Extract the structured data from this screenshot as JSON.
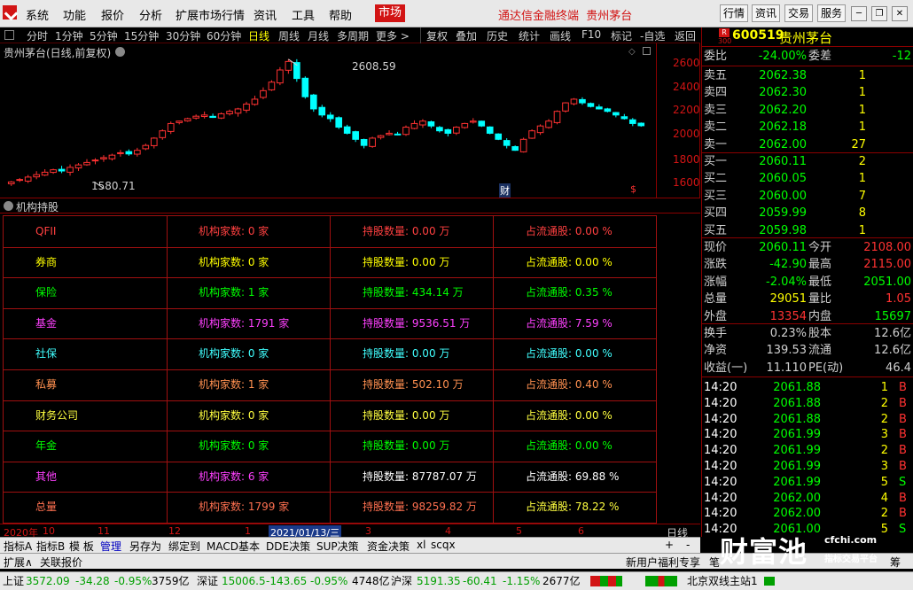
{
  "menubar": {
    "menus": [
      "系统",
      "功能",
      "报价",
      "分析",
      "扩展市场行情",
      "资讯",
      "工具",
      "帮助"
    ],
    "active_menu": "市场",
    "brand_text": "通达信金融终端",
    "brand_stock": "贵州茅台",
    "right_buttons": [
      "行情",
      "资讯",
      "交易",
      "服务"
    ]
  },
  "periodbar": {
    "items": [
      "分时",
      "1分钟",
      "5分钟",
      "15分钟",
      "30分钟",
      "60分钟",
      "日线",
      "周线",
      "月线",
      "多周期",
      "更多 >"
    ],
    "selected": "日线",
    "tools": [
      "复权",
      "叠加",
      "历史",
      "统计",
      "画线",
      "F10",
      "标记",
      "-自选",
      "返回"
    ]
  },
  "chart": {
    "title": "贵州茅台(日线,前复权)",
    "high_label": "2608.59",
    "low_label": "1580.71",
    "yticks": [
      "2600",
      "2400",
      "2200",
      "2000",
      "1800",
      "1600"
    ],
    "marker_cai": "财",
    "marker_s": "$",
    "colors": {
      "up": "#ff3232",
      "down": "#00ffff",
      "axis": "#d21414"
    }
  },
  "chart_data": {
    "type": "candlestick",
    "title": "贵州茅台(日线,前复权)",
    "ylim": [
      1530,
      2680
    ],
    "high": 2608.59,
    "low": 1580.71,
    "closes": [
      1600,
      1620,
      1640,
      1660,
      1680,
      1700,
      1690,
      1720,
      1740,
      1760,
      1780,
      1800,
      1820,
      1840,
      1830,
      1860,
      1900,
      1960,
      2020,
      2080,
      2100,
      2120,
      2140,
      2150,
      2130,
      2160,
      2180,
      2200,
      2240,
      2280,
      2350,
      2420,
      2520,
      2590,
      2450,
      2300,
      2200,
      2150,
      2120,
      2050,
      2000,
      1950,
      1900,
      1960,
      1980,
      2000,
      1990,
      2050,
      2080,
      2100,
      2060,
      2020,
      2000,
      2050,
      2080,
      2100,
      2060,
      2000,
      1950,
      1900,
      1860,
      1950,
      2020,
      2060,
      2100,
      2180,
      2250,
      2280,
      2250,
      2220,
      2200,
      2180,
      2150,
      2120,
      2080,
      2062
    ]
  },
  "panel": {
    "title": "机构持股",
    "rows": [
      {
        "type": "QFII",
        "count": "机构家数: 0 家",
        "shares": "持股数量: 0.00 万",
        "ratio": "占流通股: 0.00 %",
        "color": "#ff4040",
        "ccolor": "#ff4040",
        "scolor": "#ff4040",
        "rcolor": "#ff4040"
      },
      {
        "type": "券商",
        "count": "机构家数: 0 家",
        "shares": "持股数量: 0.00 万",
        "ratio": "占流通股: 0.00 %",
        "color": "#ffff00",
        "ccolor": "#ffff00",
        "scolor": "#ffff00",
        "rcolor": "#ffff00"
      },
      {
        "type": "保险",
        "count": "机构家数: 1 家",
        "shares": "持股数量: 434.14 万",
        "ratio": "占流通股: 0.35 %",
        "color": "#00ff00",
        "ccolor": "#00ff00",
        "scolor": "#00ff00",
        "rcolor": "#00ff00"
      },
      {
        "type": "基金",
        "count": "机构家数: 1791 家",
        "shares": "持股数量: 9536.51 万",
        "ratio": "占流通股: 7.59 %",
        "color": "#ff40ff",
        "ccolor": "#ff40ff",
        "scolor": "#ff40ff",
        "rcolor": "#ff40ff"
      },
      {
        "type": "社保",
        "count": "机构家数: 0 家",
        "shares": "持股数量: 0.00 万",
        "ratio": "占流通股: 0.00 %",
        "color": "#40ffff",
        "ccolor": "#40ffff",
        "scolor": "#40ffff",
        "rcolor": "#40ffff"
      },
      {
        "type": "私募",
        "count": "机构家数: 1 家",
        "shares": "持股数量: 502.10 万",
        "ratio": "占流通股: 0.40 %",
        "color": "#ff9050",
        "ccolor": "#ff9050",
        "scolor": "#ff9050",
        "rcolor": "#ff9050"
      },
      {
        "type": "财务公司",
        "count": "机构家数: 0 家",
        "shares": "持股数量: 0.00 万",
        "ratio": "占流通股: 0.00 %",
        "color": "#ffff40",
        "ccolor": "#ffff40",
        "scolor": "#ffff40",
        "rcolor": "#ffff40"
      },
      {
        "type": "年金",
        "count": "机构家数: 0 家",
        "shares": "持股数量: 0.00 万",
        "ratio": "占流通股: 0.00 %",
        "color": "#00ff00",
        "ccolor": "#00ff00",
        "scolor": "#00ff00",
        "rcolor": "#00ff00"
      },
      {
        "type": "其他",
        "count": "机构家数: 6 家",
        "shares": "持股数量: 87787.07 万",
        "ratio": "占流通股: 69.88 %",
        "color": "#ff40ff",
        "ccolor": "#ff40ff",
        "scolor": "#ffffff",
        "rcolor": "#ffffff"
      },
      {
        "type": "总量",
        "count": "机构家数: 1799 家",
        "shares": "持股数量: 98259.82 万",
        "ratio": "占流通股: 78.22 %",
        "color": "#ff7050",
        "ccolor": "#ff7050",
        "scolor": "#ff7050",
        "rcolor": "#ffff40"
      }
    ]
  },
  "timeaxis": {
    "labels": [
      "2020年",
      "10",
      "11",
      "12",
      "1",
      "2021/01/13/三",
      "3",
      "4",
      "5",
      "6"
    ],
    "period": "日线"
  },
  "tabs1": {
    "items": [
      "指标A",
      "指标B",
      "模 板",
      "管理",
      "另存为",
      "绑定到",
      "MACD基本",
      "DDE决策",
      "SUP决策",
      "资金决策",
      "xl",
      "scqx"
    ],
    "selected": "管理",
    "plus": "+",
    "minus": "-"
  },
  "tabs2": {
    "items": [
      "扩展∧",
      "关联报价"
    ],
    "right_text": "新用户福利专享",
    "right_tabs": [
      "笔",
      "价",
      "细",
      "势",
      "联",
      "值",
      "主",
      "筹"
    ]
  },
  "statusbar": {
    "sh": {
      "label": "上证",
      "value": "3572.09",
      "chg": "-34.28",
      "pct": "-0.95%",
      "vol": "3759亿"
    },
    "sz": {
      "label": "深证",
      "value": "15006.5",
      "chg": "-143.65",
      "pct": "-0.95%",
      "vol": "4748亿"
    },
    "hs": {
      "label": "沪深",
      "value": "5191.35",
      "chg": "-60.41",
      "pct": "-1.15%",
      "vol": "2677亿"
    },
    "server": "北京双线主站1"
  },
  "quote": {
    "market_badge": "R",
    "market_num": "300",
    "code": "600519",
    "name": "贵州茅台",
    "weibi_label": "委比",
    "weibi": "-24.00%",
    "weicha_label": "委差",
    "weicha": "-12",
    "asks": [
      {
        "label": "卖五",
        "price": "2062.38",
        "vol": "1"
      },
      {
        "label": "卖四",
        "price": "2062.30",
        "vol": "1"
      },
      {
        "label": "卖三",
        "price": "2062.20",
        "vol": "1"
      },
      {
        "label": "卖二",
        "price": "2062.18",
        "vol": "1"
      },
      {
        "label": "卖一",
        "price": "2062.00",
        "vol": "27"
      }
    ],
    "bids": [
      {
        "label": "买一",
        "price": "2060.11",
        "vol": "2"
      },
      {
        "label": "买二",
        "price": "2060.05",
        "vol": "1"
      },
      {
        "label": "买三",
        "price": "2060.00",
        "vol": "7"
      },
      {
        "label": "买四",
        "price": "2059.99",
        "vol": "8"
      },
      {
        "label": "买五",
        "price": "2059.98",
        "vol": "1"
      }
    ],
    "stats": [
      {
        "l1": "现价",
        "v1": "2060.11",
        "c1": "#00ff00",
        "l2": "今开",
        "v2": "2108.00",
        "c2": "#ff3232"
      },
      {
        "l1": "涨跌",
        "v1": "-42.90",
        "c1": "#00ff00",
        "l2": "最高",
        "v2": "2115.00",
        "c2": "#ff3232"
      },
      {
        "l1": "涨幅",
        "v1": "-2.04%",
        "c1": "#00ff00",
        "l2": "最低",
        "v2": "2051.00",
        "c2": "#00ff00"
      },
      {
        "l1": "总量",
        "v1": "29051",
        "c1": "#ffff00",
        "l2": "量比",
        "v2": "1.05",
        "c2": "#ff3232"
      },
      {
        "l1": "外盘",
        "v1": "13354",
        "c1": "#ff3232",
        "l2": "内盘",
        "v2": "15697",
        "c2": "#00ff00"
      }
    ],
    "fin": [
      {
        "l1": "换手",
        "v1": "0.23%",
        "l2": "股本",
        "v2": "12.6亿"
      },
      {
        "l1": "净资",
        "v1": "139.53",
        "l2": "流通",
        "v2": "12.6亿"
      },
      {
        "l1": "收益(一)",
        "v1": "11.110",
        "l2": "PE(动)",
        "v2": "46.4"
      }
    ],
    "ticks": [
      {
        "t": "14:20",
        "p": "2061.88",
        "v": "1",
        "d": "B"
      },
      {
        "t": "14:20",
        "p": "2061.88",
        "v": "2",
        "d": "B"
      },
      {
        "t": "14:20",
        "p": "2061.88",
        "v": "2",
        "d": "B"
      },
      {
        "t": "14:20",
        "p": "2061.99",
        "v": "3",
        "d": "B"
      },
      {
        "t": "14:20",
        "p": "2061.99",
        "v": "2",
        "d": "B"
      },
      {
        "t": "14:20",
        "p": "2061.99",
        "v": "3",
        "d": "B"
      },
      {
        "t": "14:20",
        "p": "2061.99",
        "v": "5",
        "d": "S"
      },
      {
        "t": "14:20",
        "p": "2062.00",
        "v": "4",
        "d": "B"
      },
      {
        "t": "14:20",
        "p": "2062.00",
        "v": "2",
        "d": "B"
      },
      {
        "t": "14:20",
        "p": "2061.00",
        "v": "5",
        "d": "S"
      }
    ]
  },
  "watermark": {
    "main": "财富池",
    "site": "cfchi.com",
    "sub": "指标交易平台"
  }
}
